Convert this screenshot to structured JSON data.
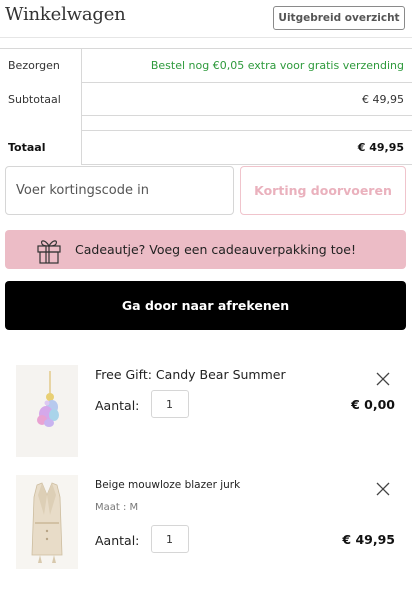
{
  "header": {
    "title": "Winkelwagen",
    "overview_button": "Uitgebreid overzicht"
  },
  "summary": {
    "delivery_label": "Bezorgen",
    "delivery_message": "Bestel nog €0,05 extra voor gratis verzending",
    "subtotal_label": "Subtotaal",
    "subtotal_value": "€ 49,95",
    "total_label": "Totaal",
    "total_value": "€ 49,95"
  },
  "coupon": {
    "placeholder": "Voer kortingscode in",
    "button_label": "Korting doorvoeren"
  },
  "gift_banner": {
    "text": "Cadeautje? Voeg een cadeauverpakking toe!"
  },
  "checkout": {
    "button_label": "Ga door naar afrekenen"
  },
  "items": [
    {
      "name": "Free Gift: Candy Bear Summer",
      "qty_label": "Aantal:",
      "qty": "1",
      "price": "€ 0,00"
    },
    {
      "name": "Beige mouwloze blazer jurk",
      "meta": "Maat : M",
      "qty_label": "Aantal:",
      "qty": "1",
      "price": "€ 49,95"
    }
  ],
  "colors": {
    "accent_pink": "#ecbcc6",
    "coupon_text_pink": "#eab1bd",
    "free_shipping_green": "#2e9a3c",
    "checkout_black": "#000000"
  }
}
